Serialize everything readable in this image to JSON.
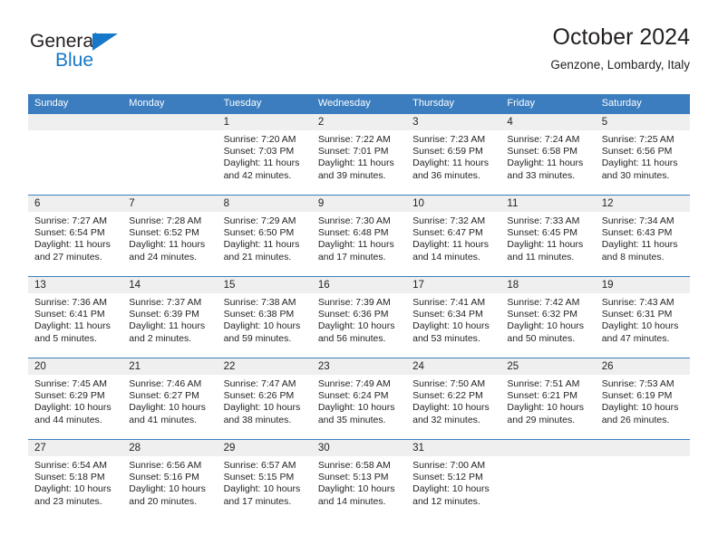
{
  "brand": {
    "name_part1": "General",
    "name_part2": "Blue",
    "triangle_icon": "triangle-icon",
    "color_dark": "#231f20",
    "color_blue": "#1578c8"
  },
  "header": {
    "title": "October 2024",
    "location": "Genzone, Lombardy, Italy"
  },
  "theme": {
    "header_bar": "#3b7dbf",
    "daynum_band": "#efefef",
    "row_rule": "#3b7dbf",
    "text": "#231f20"
  },
  "weekdays": [
    "Sunday",
    "Monday",
    "Tuesday",
    "Wednesday",
    "Thursday",
    "Friday",
    "Saturday"
  ],
  "weeks": [
    [
      {
        "day": "",
        "l1": "",
        "l2": "",
        "l3": "",
        "l4": ""
      },
      {
        "day": "",
        "l1": "",
        "l2": "",
        "l3": "",
        "l4": ""
      },
      {
        "day": "1",
        "l1": "Sunrise: 7:20 AM",
        "l2": "Sunset: 7:03 PM",
        "l3": "Daylight: 11 hours",
        "l4": "and 42 minutes."
      },
      {
        "day": "2",
        "l1": "Sunrise: 7:22 AM",
        "l2": "Sunset: 7:01 PM",
        "l3": "Daylight: 11 hours",
        "l4": "and 39 minutes."
      },
      {
        "day": "3",
        "l1": "Sunrise: 7:23 AM",
        "l2": "Sunset: 6:59 PM",
        "l3": "Daylight: 11 hours",
        "l4": "and 36 minutes."
      },
      {
        "day": "4",
        "l1": "Sunrise: 7:24 AM",
        "l2": "Sunset: 6:58 PM",
        "l3": "Daylight: 11 hours",
        "l4": "and 33 minutes."
      },
      {
        "day": "5",
        "l1": "Sunrise: 7:25 AM",
        "l2": "Sunset: 6:56 PM",
        "l3": "Daylight: 11 hours",
        "l4": "and 30 minutes."
      }
    ],
    [
      {
        "day": "6",
        "l1": "Sunrise: 7:27 AM",
        "l2": "Sunset: 6:54 PM",
        "l3": "Daylight: 11 hours",
        "l4": "and 27 minutes."
      },
      {
        "day": "7",
        "l1": "Sunrise: 7:28 AM",
        "l2": "Sunset: 6:52 PM",
        "l3": "Daylight: 11 hours",
        "l4": "and 24 minutes."
      },
      {
        "day": "8",
        "l1": "Sunrise: 7:29 AM",
        "l2": "Sunset: 6:50 PM",
        "l3": "Daylight: 11 hours",
        "l4": "and 21 minutes."
      },
      {
        "day": "9",
        "l1": "Sunrise: 7:30 AM",
        "l2": "Sunset: 6:48 PM",
        "l3": "Daylight: 11 hours",
        "l4": "and 17 minutes."
      },
      {
        "day": "10",
        "l1": "Sunrise: 7:32 AM",
        "l2": "Sunset: 6:47 PM",
        "l3": "Daylight: 11 hours",
        "l4": "and 14 minutes."
      },
      {
        "day": "11",
        "l1": "Sunrise: 7:33 AM",
        "l2": "Sunset: 6:45 PM",
        "l3": "Daylight: 11 hours",
        "l4": "and 11 minutes."
      },
      {
        "day": "12",
        "l1": "Sunrise: 7:34 AM",
        "l2": "Sunset: 6:43 PM",
        "l3": "Daylight: 11 hours",
        "l4": "and 8 minutes."
      }
    ],
    [
      {
        "day": "13",
        "l1": "Sunrise: 7:36 AM",
        "l2": "Sunset: 6:41 PM",
        "l3": "Daylight: 11 hours",
        "l4": "and 5 minutes."
      },
      {
        "day": "14",
        "l1": "Sunrise: 7:37 AM",
        "l2": "Sunset: 6:39 PM",
        "l3": "Daylight: 11 hours",
        "l4": "and 2 minutes."
      },
      {
        "day": "15",
        "l1": "Sunrise: 7:38 AM",
        "l2": "Sunset: 6:38 PM",
        "l3": "Daylight: 10 hours",
        "l4": "and 59 minutes."
      },
      {
        "day": "16",
        "l1": "Sunrise: 7:39 AM",
        "l2": "Sunset: 6:36 PM",
        "l3": "Daylight: 10 hours",
        "l4": "and 56 minutes."
      },
      {
        "day": "17",
        "l1": "Sunrise: 7:41 AM",
        "l2": "Sunset: 6:34 PM",
        "l3": "Daylight: 10 hours",
        "l4": "and 53 minutes."
      },
      {
        "day": "18",
        "l1": "Sunrise: 7:42 AM",
        "l2": "Sunset: 6:32 PM",
        "l3": "Daylight: 10 hours",
        "l4": "and 50 minutes."
      },
      {
        "day": "19",
        "l1": "Sunrise: 7:43 AM",
        "l2": "Sunset: 6:31 PM",
        "l3": "Daylight: 10 hours",
        "l4": "and 47 minutes."
      }
    ],
    [
      {
        "day": "20",
        "l1": "Sunrise: 7:45 AM",
        "l2": "Sunset: 6:29 PM",
        "l3": "Daylight: 10 hours",
        "l4": "and 44 minutes."
      },
      {
        "day": "21",
        "l1": "Sunrise: 7:46 AM",
        "l2": "Sunset: 6:27 PM",
        "l3": "Daylight: 10 hours",
        "l4": "and 41 minutes."
      },
      {
        "day": "22",
        "l1": "Sunrise: 7:47 AM",
        "l2": "Sunset: 6:26 PM",
        "l3": "Daylight: 10 hours",
        "l4": "and 38 minutes."
      },
      {
        "day": "23",
        "l1": "Sunrise: 7:49 AM",
        "l2": "Sunset: 6:24 PM",
        "l3": "Daylight: 10 hours",
        "l4": "and 35 minutes."
      },
      {
        "day": "24",
        "l1": "Sunrise: 7:50 AM",
        "l2": "Sunset: 6:22 PM",
        "l3": "Daylight: 10 hours",
        "l4": "and 32 minutes."
      },
      {
        "day": "25",
        "l1": "Sunrise: 7:51 AM",
        "l2": "Sunset: 6:21 PM",
        "l3": "Daylight: 10 hours",
        "l4": "and 29 minutes."
      },
      {
        "day": "26",
        "l1": "Sunrise: 7:53 AM",
        "l2": "Sunset: 6:19 PM",
        "l3": "Daylight: 10 hours",
        "l4": "and 26 minutes."
      }
    ],
    [
      {
        "day": "27",
        "l1": "Sunrise: 6:54 AM",
        "l2": "Sunset: 5:18 PM",
        "l3": "Daylight: 10 hours",
        "l4": "and 23 minutes."
      },
      {
        "day": "28",
        "l1": "Sunrise: 6:56 AM",
        "l2": "Sunset: 5:16 PM",
        "l3": "Daylight: 10 hours",
        "l4": "and 20 minutes."
      },
      {
        "day": "29",
        "l1": "Sunrise: 6:57 AM",
        "l2": "Sunset: 5:15 PM",
        "l3": "Daylight: 10 hours",
        "l4": "and 17 minutes."
      },
      {
        "day": "30",
        "l1": "Sunrise: 6:58 AM",
        "l2": "Sunset: 5:13 PM",
        "l3": "Daylight: 10 hours",
        "l4": "and 14 minutes."
      },
      {
        "day": "31",
        "l1": "Sunrise: 7:00 AM",
        "l2": "Sunset: 5:12 PM",
        "l3": "Daylight: 10 hours",
        "l4": "and 12 minutes."
      },
      {
        "day": "",
        "l1": "",
        "l2": "",
        "l3": "",
        "l4": ""
      },
      {
        "day": "",
        "l1": "",
        "l2": "",
        "l3": "",
        "l4": ""
      }
    ]
  ]
}
